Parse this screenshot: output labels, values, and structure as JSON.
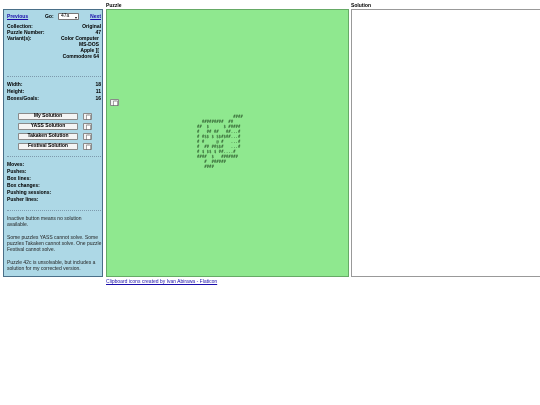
{
  "headers": {
    "puzzle": "Puzzle",
    "solution": "Solution"
  },
  "nav": {
    "previous": "Previous",
    "go": "Go:",
    "selected": "47a",
    "next": "Next"
  },
  "info": {
    "collection_k": "Collection:",
    "collection_v": "Original",
    "number_k": "Puzzle Number:",
    "number_v": "47",
    "variants_k": "Variant(s):",
    "variants": [
      "Color Computer",
      "MS-DOS",
      "Apple ][",
      "Commodore 64"
    ],
    "width_k": "Width:",
    "width_v": "18",
    "height_k": "Height:",
    "height_v": "11",
    "boxes_k": "Boxes/Goals:",
    "boxes_v": "16"
  },
  "buttons": {
    "my": "My Solution",
    "yass": "YASS Solution",
    "takaken": "Takaken Solution",
    "festival": "Festival Solution"
  },
  "stats": [
    "Moves:",
    "Pushes:",
    "Box lines:",
    "Box changes:",
    "Pushing sessions:",
    "Pusher lines:"
  ],
  "notes": [
    "Inactive button means no solution available.",
    "Some puzzles YASS cannot solve. Some puzzles Takaken cannot solve. One puzzle Festival cannot solve.",
    "Puzzle 42c is unsolvable, but includes a solution for my corrected version."
  ],
  "puzzle_map": "               ####\n  #########  ##\n##  $      $ #####\n#   ## ##   ##...#\n# #$$ $ $$#$##...#\n# #     @ #   ...#\n#  ## ##$$#   ...#\n# $ $$ $ ##....#\n####  $   #######\n   #  ######\n   ####",
  "credit": "Clipboard icons created by Ivan Abirawa - Flaticon"
}
